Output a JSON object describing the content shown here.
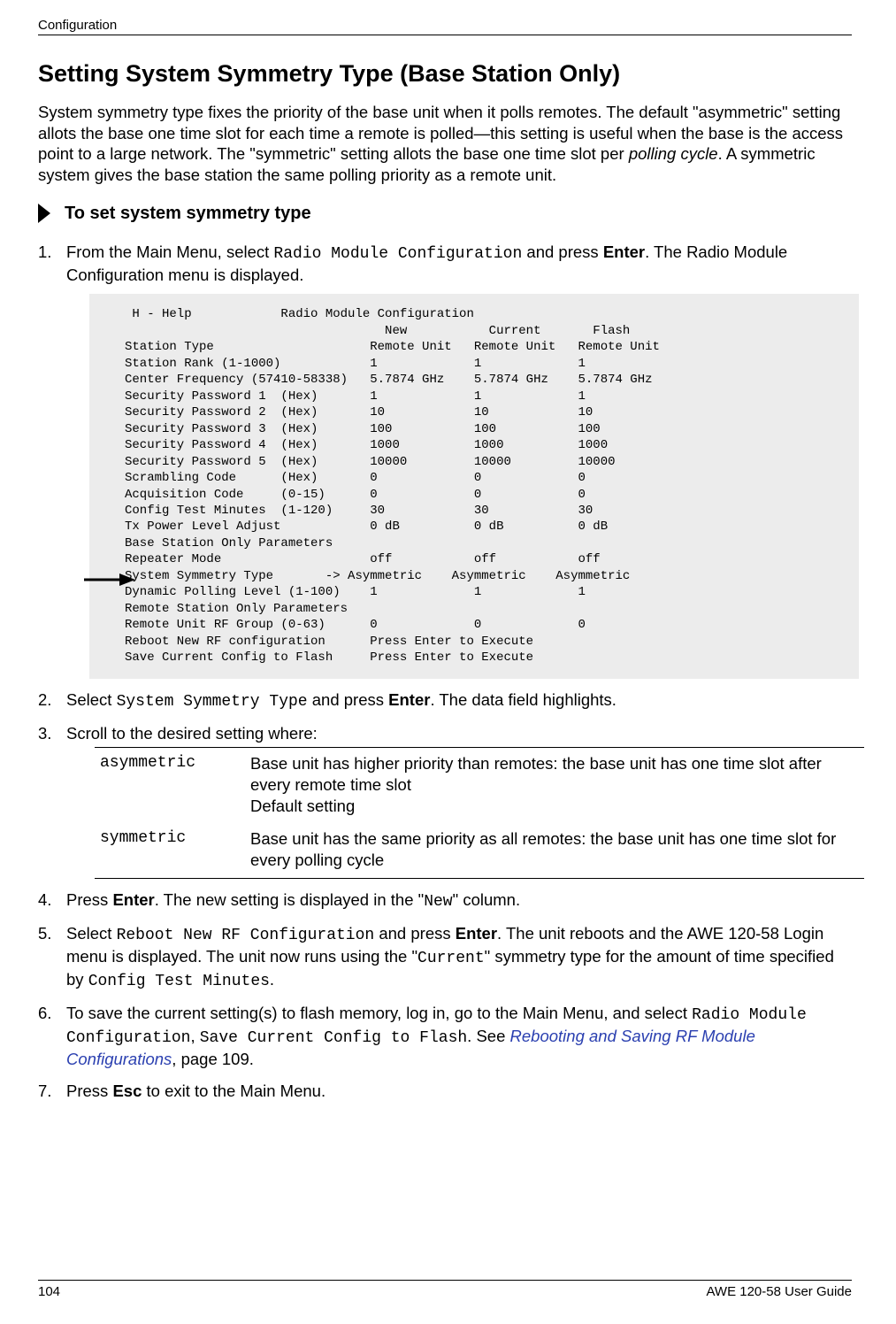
{
  "header": {
    "running_head": "Configuration"
  },
  "title": "Setting System Symmetry Type (Base Station Only)",
  "intro": {
    "pre": "System symmetry type fixes the priority of the base unit when it polls remotes. The default \"asymmetric\" setting allots the base one time slot for each time a remote is polled—this setting is useful when the base is the access point to a large network. The \"symmetric\" setting allots the base one time slot per ",
    "em": "polling cycle",
    "post": ". A symmetric system gives the base station the same polling priority as a remote unit."
  },
  "procedure_heading": "To set system symmetry type",
  "steps": {
    "s1a": "From the Main Menu, select ",
    "s1_code": "Radio Module Configuration",
    "s1b": " and press ",
    "s1_enter": "Enter",
    "s1c": ". The Radio Module Configuration menu is displayed.",
    "s2a": "Select ",
    "s2_code": "System Symmetry Type",
    "s2b": " and press ",
    "s2_enter": "Enter",
    "s2c": ". The data field highlights.",
    "s3": "Scroll to the desired setting where:",
    "s4a": "Press ",
    "s4_enter": "Enter",
    "s4b": ". The new setting is displayed in the \"",
    "s4_new": "New",
    "s4c": "\" column.",
    "s5a": "Select ",
    "s5_code1": "Reboot New RF Configuration",
    "s5b": " and press ",
    "s5_enter": "Enter",
    "s5c": ". The unit reboots and the AWE 120-58 Login menu is displayed. The unit now runs using the \"",
    "s5_current": "Current",
    "s5d": "\" symmetry type for the amount of time specified by ",
    "s5_code2": "Config Test Minutes",
    "s5e": ".",
    "s6a": "To save the current setting(s) to flash memory, log in, go to the Main Menu, and select ",
    "s6_code1": "Radio Module Configuration",
    "s6b": ", ",
    "s6_code2": "Save Current Config to Flash",
    "s6c": ". See ",
    "s6_link": "Rebooting and Saving RF Module Configurations",
    "s6d": ", page 109.",
    "s7a": "Press ",
    "s7_esc": "Esc",
    "s7b": " to exit to the Main Menu."
  },
  "options": {
    "asym_key": "asymmetric",
    "asym_line1": "Base unit has higher priority than remotes: the base unit has one time slot after every remote time slot",
    "asym_line2": "Default setting",
    "sym_key": "symmetric",
    "sym_desc": "Base unit has the same priority as all remotes: the base unit has one time slot for every polling cycle"
  },
  "terminal": {
    "help_line": " H - Help            Radio Module Configuration",
    "col_headers": {
      "new": "New",
      "current": "Current",
      "flash": "Flash"
    },
    "rows": [
      {
        "label": "Station Type",
        "new": "Remote Unit",
        "current": "Remote Unit",
        "flash": "Remote Unit"
      },
      {
        "label": "Station Rank (1-1000)",
        "new": "1",
        "current": "1",
        "flash": "1"
      },
      {
        "label": "Center Frequency (57410-58338)",
        "new": "5.7874 GHz",
        "current": "5.7874 GHz",
        "flash": "5.7874 GHz"
      },
      {
        "label": "Security Password 1  (Hex)",
        "new": "1",
        "current": "1",
        "flash": "1"
      },
      {
        "label": "Security Password 2  (Hex)",
        "new": "10",
        "current": "10",
        "flash": "10"
      },
      {
        "label": "Security Password 3  (Hex)",
        "new": "100",
        "current": "100",
        "flash": "100"
      },
      {
        "label": "Security Password 4  (Hex)",
        "new": "1000",
        "current": "1000",
        "flash": "1000"
      },
      {
        "label": "Security Password 5  (Hex)",
        "new": "10000",
        "current": "10000",
        "flash": "10000"
      },
      {
        "label": "Scrambling Code      (Hex)",
        "new": "0",
        "current": "0",
        "flash": "0"
      },
      {
        "label": "Acquisition Code     (0-15)",
        "new": "0",
        "current": "0",
        "flash": "0"
      },
      {
        "label": "Config Test Minutes  (1-120)",
        "new": "30",
        "current": "30",
        "flash": "30"
      },
      {
        "label": "Tx Power Level Adjust",
        "new": "0 dB",
        "current": "0 dB",
        "flash": "0 dB"
      },
      {
        "label": "Base Station Only Parameters",
        "new": "",
        "current": "",
        "flash": ""
      },
      {
        "label": "Repeater Mode",
        "new": "off",
        "current": "off",
        "flash": "off"
      },
      {
        "label": "System Symmetry Type",
        "prefix": "-> ",
        "new": "Asymmetric",
        "current": "Asymmetric",
        "flash": "Asymmetric"
      },
      {
        "label": "Dynamic Polling Level (1-100)",
        "new": "1",
        "current": "1",
        "flash": "1"
      },
      {
        "label": "Remote Station Only Parameters",
        "new": "",
        "current": "",
        "flash": ""
      },
      {
        "label": "Remote Unit RF Group (0-63)",
        "new": "0",
        "current": "0",
        "flash": "0"
      }
    ],
    "blank": "",
    "reboot_line": {
      "label": "Reboot New RF configuration",
      "value": "Press Enter to Execute"
    },
    "save_line": {
      "label": "Save Current Config to Flash",
      "value": "Press Enter to Execute"
    },
    "highlight_index": 14
  },
  "footer": {
    "page": "104",
    "guide": "AWE 120-58 User Guide"
  }
}
